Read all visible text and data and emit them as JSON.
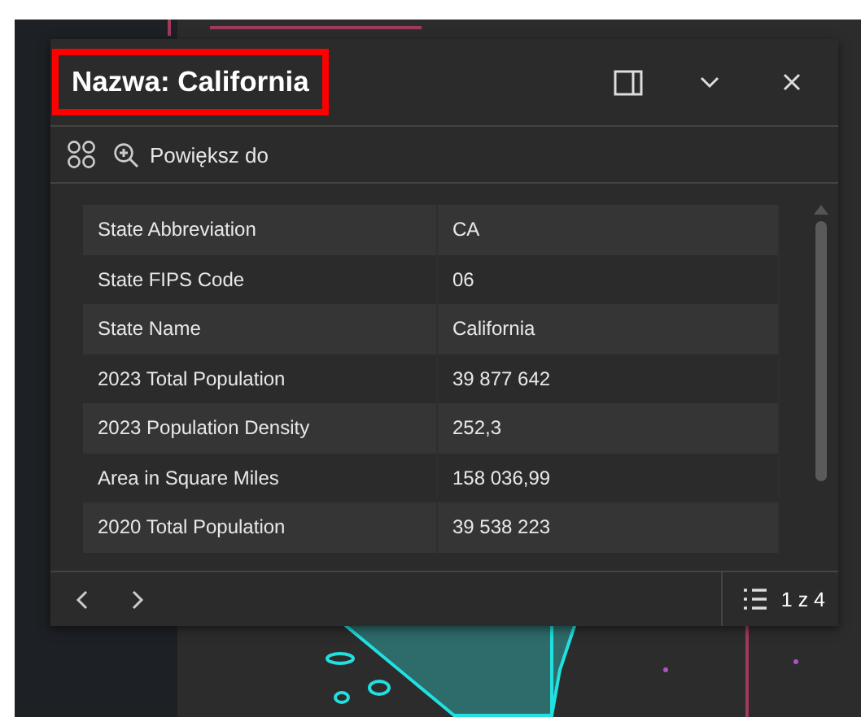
{
  "popup": {
    "title": "Nazwa: California",
    "highlighted": true,
    "toolbar": {
      "zoom_label": "Powiększ do"
    },
    "fields": [
      {
        "name": "State Abbreviation",
        "value": "CA"
      },
      {
        "name": "State FIPS Code",
        "value": "06"
      },
      {
        "name": "State Name",
        "value": "California"
      },
      {
        "name": "2023 Total Population",
        "value": "39 877 642"
      },
      {
        "name": "2023 Population Density",
        "value": "252,3"
      },
      {
        "name": "Area in Square Miles",
        "value": "158 036,99"
      },
      {
        "name": "2020 Total Population",
        "value": "39 538 223"
      }
    ],
    "pager": "1 z 4"
  }
}
